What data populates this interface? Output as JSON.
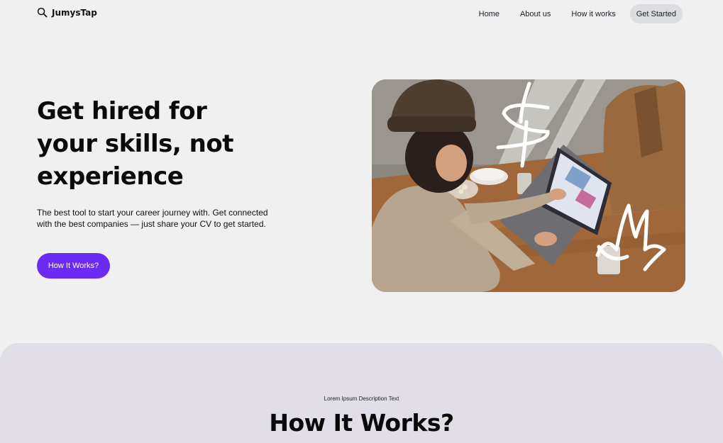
{
  "brand": {
    "name": "JumysTap",
    "icon": "search-icon"
  },
  "nav": {
    "links": [
      "Home",
      "About us",
      "How it works"
    ],
    "cta": "Get Started"
  },
  "hero": {
    "title_lines": [
      "Get hired for",
      "your skills, not",
      "experience"
    ],
    "description_lines": [
      "The best tool to start your career journey with. Get connected",
      "with the best companies — just share your CV to get started."
    ],
    "button": "How It Works?",
    "image": "photo-woman-using-laptop"
  },
  "how_section": {
    "kicker": "Lorem Ipsum Description Text",
    "title": "How It Works?"
  },
  "colors": {
    "background": "#f1f0f1",
    "accent": "#6c2bf2",
    "section_bg": "#e1dee7",
    "nav_cta_bg": "#dcdde0"
  }
}
